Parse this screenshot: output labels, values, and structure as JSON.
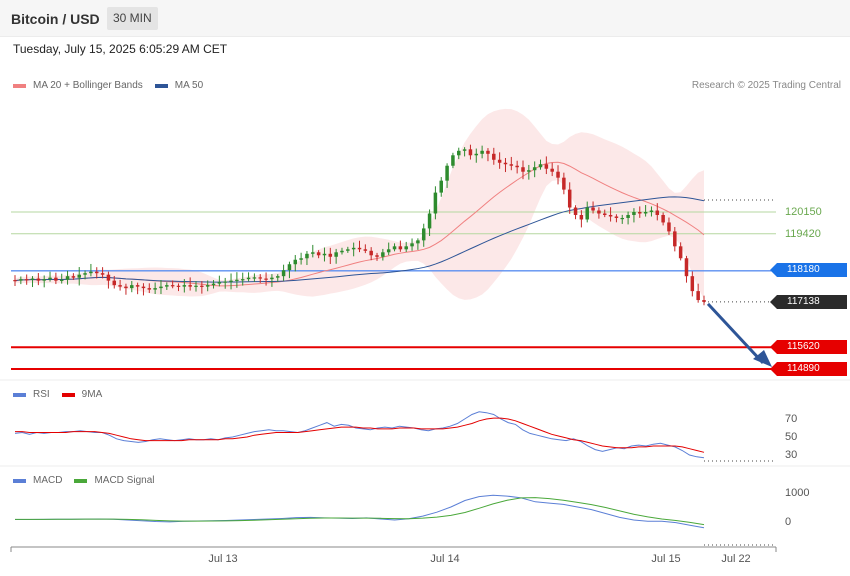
{
  "header": {
    "title": "Bitcoin / USD",
    "timeframe": "30 MIN"
  },
  "datetime": "Tuesday, July 15, 2025 6:05:29 AM CET",
  "legend": {
    "ma20": {
      "label": "MA 20 + Bollinger Bands",
      "color": "#f08080"
    },
    "ma50": {
      "label": "MA 50",
      "color": "#2e5597"
    }
  },
  "credit": "Research © 2025 Trading Central",
  "levels": {
    "resistance": [
      {
        "value": "120150",
        "color": "#6aa84f"
      },
      {
        "value": "119420",
        "color": "#6aa84f"
      }
    ],
    "pivot": {
      "value": "118180",
      "color": "#1a73e8"
    },
    "current": {
      "value": "117138",
      "color": "#2b2b2b"
    },
    "support": [
      {
        "value": "115620",
        "color": "#e60000"
      },
      {
        "value": "114890",
        "color": "#e60000"
      }
    ]
  },
  "rsi": {
    "legend": {
      "rsi": "RSI",
      "ma": "9MA"
    },
    "ticks": [
      "70",
      "50",
      "30"
    ],
    "colors": {
      "rsi": "#5b7fd6",
      "ma": "#e30000"
    }
  },
  "macd": {
    "legend": {
      "macd": "MACD",
      "signal": "MACD Signal"
    },
    "ticks": [
      "1000",
      "0"
    ],
    "colors": {
      "macd": "#5b7fd6",
      "signal": "#4aa83a"
    }
  },
  "x_axis": [
    "Jul 13",
    "Jul 14",
    "Jul 15",
    "Jul 22"
  ],
  "chart_data": [
    {
      "type": "candlestick",
      "title": "Bitcoin / USD",
      "timeframe": "30 MIN",
      "x_ticks": [
        "Jul 13",
        "Jul 14",
        "Jul 15",
        "Jul 22"
      ],
      "y_levels": [
        120150,
        119420,
        118180,
        117138,
        115620,
        114890
      ],
      "close_approx": [
        117850,
        117900,
        117880,
        117920,
        117850,
        117900,
        117950,
        117850,
        117880,
        118000,
        117950,
        118050,
        118100,
        118150,
        118100,
        118050,
        117850,
        117700,
        117650,
        117600,
        117700,
        117650,
        117600,
        117550,
        117600,
        117650,
        117700,
        117680,
        117650,
        117700,
        117650,
        117680,
        117650,
        117700,
        117750,
        117800,
        117820,
        117850,
        117880,
        117900,
        117950,
        117960,
        117920,
        117900,
        117950,
        118000,
        118200,
        118400,
        118550,
        118600,
        118750,
        118800,
        118700,
        118750,
        118650,
        118800,
        118850,
        118900,
        118950,
        118900,
        118850,
        118700,
        118650,
        118800,
        118900,
        119000,
        118900,
        119000,
        119100,
        119200,
        119600,
        120100,
        120800,
        121200,
        121700,
        122050,
        122200,
        122250,
        122050,
        122100,
        122200,
        122100,
        121900,
        121800,
        121750,
        121700,
        121650,
        121500,
        121550,
        121650,
        121750,
        121600,
        121500,
        121300,
        120900,
        120300,
        120050,
        119900,
        120300,
        120200,
        120100,
        120050,
        120000,
        119950,
        119950,
        120050,
        120150,
        120100,
        120150,
        120200,
        120050,
        119800,
        119500,
        119000,
        118600,
        118000,
        117500,
        117200,
        117138
      ],
      "series": [
        {
          "name": "MA 20 + Bollinger Bands"
        },
        {
          "name": "MA 50"
        }
      ]
    },
    {
      "type": "line",
      "series": [
        {
          "name": "RSI",
          "values": [
            54,
            55,
            53,
            55,
            54,
            55,
            55,
            56,
            56,
            57,
            56,
            55,
            55,
            52,
            48,
            46,
            45,
            44,
            45,
            47,
            48,
            47,
            46,
            47,
            48,
            47,
            47,
            48,
            47,
            49,
            50,
            52,
            54,
            56,
            57,
            58,
            57,
            57,
            56,
            55,
            57,
            60,
            63,
            66,
            62,
            64,
            63,
            60,
            59,
            58,
            60,
            61,
            60,
            62,
            61,
            60,
            58,
            57,
            59,
            60,
            62,
            65,
            70,
            75,
            78,
            77,
            75,
            70,
            66,
            64,
            58,
            54,
            52,
            50,
            48,
            47,
            46,
            48,
            45,
            40,
            36,
            34,
            36,
            38,
            37,
            40,
            41,
            40,
            42,
            43,
            41,
            39,
            35,
            30,
            28,
            27
          ]
        },
        {
          "name": "9MA",
          "values": [
            56,
            56,
            55,
            55,
            55,
            55,
            55,
            55,
            56,
            56,
            56,
            56,
            55,
            54,
            52,
            50,
            48,
            47,
            46,
            46,
            46,
            46,
            46,
            46,
            47,
            47,
            47,
            47,
            47,
            48,
            48,
            49,
            50,
            52,
            53,
            54,
            55,
            55,
            55,
            55,
            56,
            57,
            58,
            59,
            60,
            61,
            61,
            61,
            60,
            60,
            59,
            59,
            59,
            60,
            60,
            60,
            59,
            59,
            59,
            59,
            60,
            61,
            63,
            65,
            68,
            70,
            71,
            71,
            70,
            68,
            65,
            62,
            59,
            56,
            53,
            51,
            49,
            47,
            46,
            44,
            42,
            40,
            39,
            38,
            38,
            38,
            39,
            39,
            40,
            40,
            40,
            40,
            39,
            37,
            35,
            33
          ]
        }
      ],
      "y_ticks": [
        70,
        50,
        30
      ]
    },
    {
      "type": "line",
      "series": [
        {
          "name": "MACD",
          "values": [
            20,
            20,
            25,
            30,
            30,
            35,
            40,
            30,
            0,
            -30,
            -60,
            -70,
            -50,
            -40,
            -30,
            -20,
            0,
            20,
            40,
            60,
            90,
            100,
            80,
            70,
            60,
            80,
            40,
            0,
            50,
            150,
            300,
            500,
            750,
            900,
            950,
            920,
            850,
            700,
            650,
            600,
            500,
            400,
            250,
            100,
            0,
            -50,
            -50,
            -100,
            -200,
            -300
          ]
        },
        {
          "name": "MACD Signal",
          "values": [
            25,
            25,
            25,
            28,
            30,
            32,
            35,
            33,
            25,
            10,
            -15,
            -35,
            -45,
            -45,
            -40,
            -35,
            -25,
            -10,
            10,
            30,
            50,
            65,
            75,
            75,
            72,
            70,
            65,
            55,
            50,
            70,
            110,
            180,
            290,
            450,
            620,
            760,
            850,
            860,
            820,
            760,
            680,
            590,
            480,
            350,
            220,
            120,
            40,
            -20,
            -90,
            -180
          ]
        }
      ],
      "y_ticks": [
        1000,
        0
      ]
    }
  ]
}
